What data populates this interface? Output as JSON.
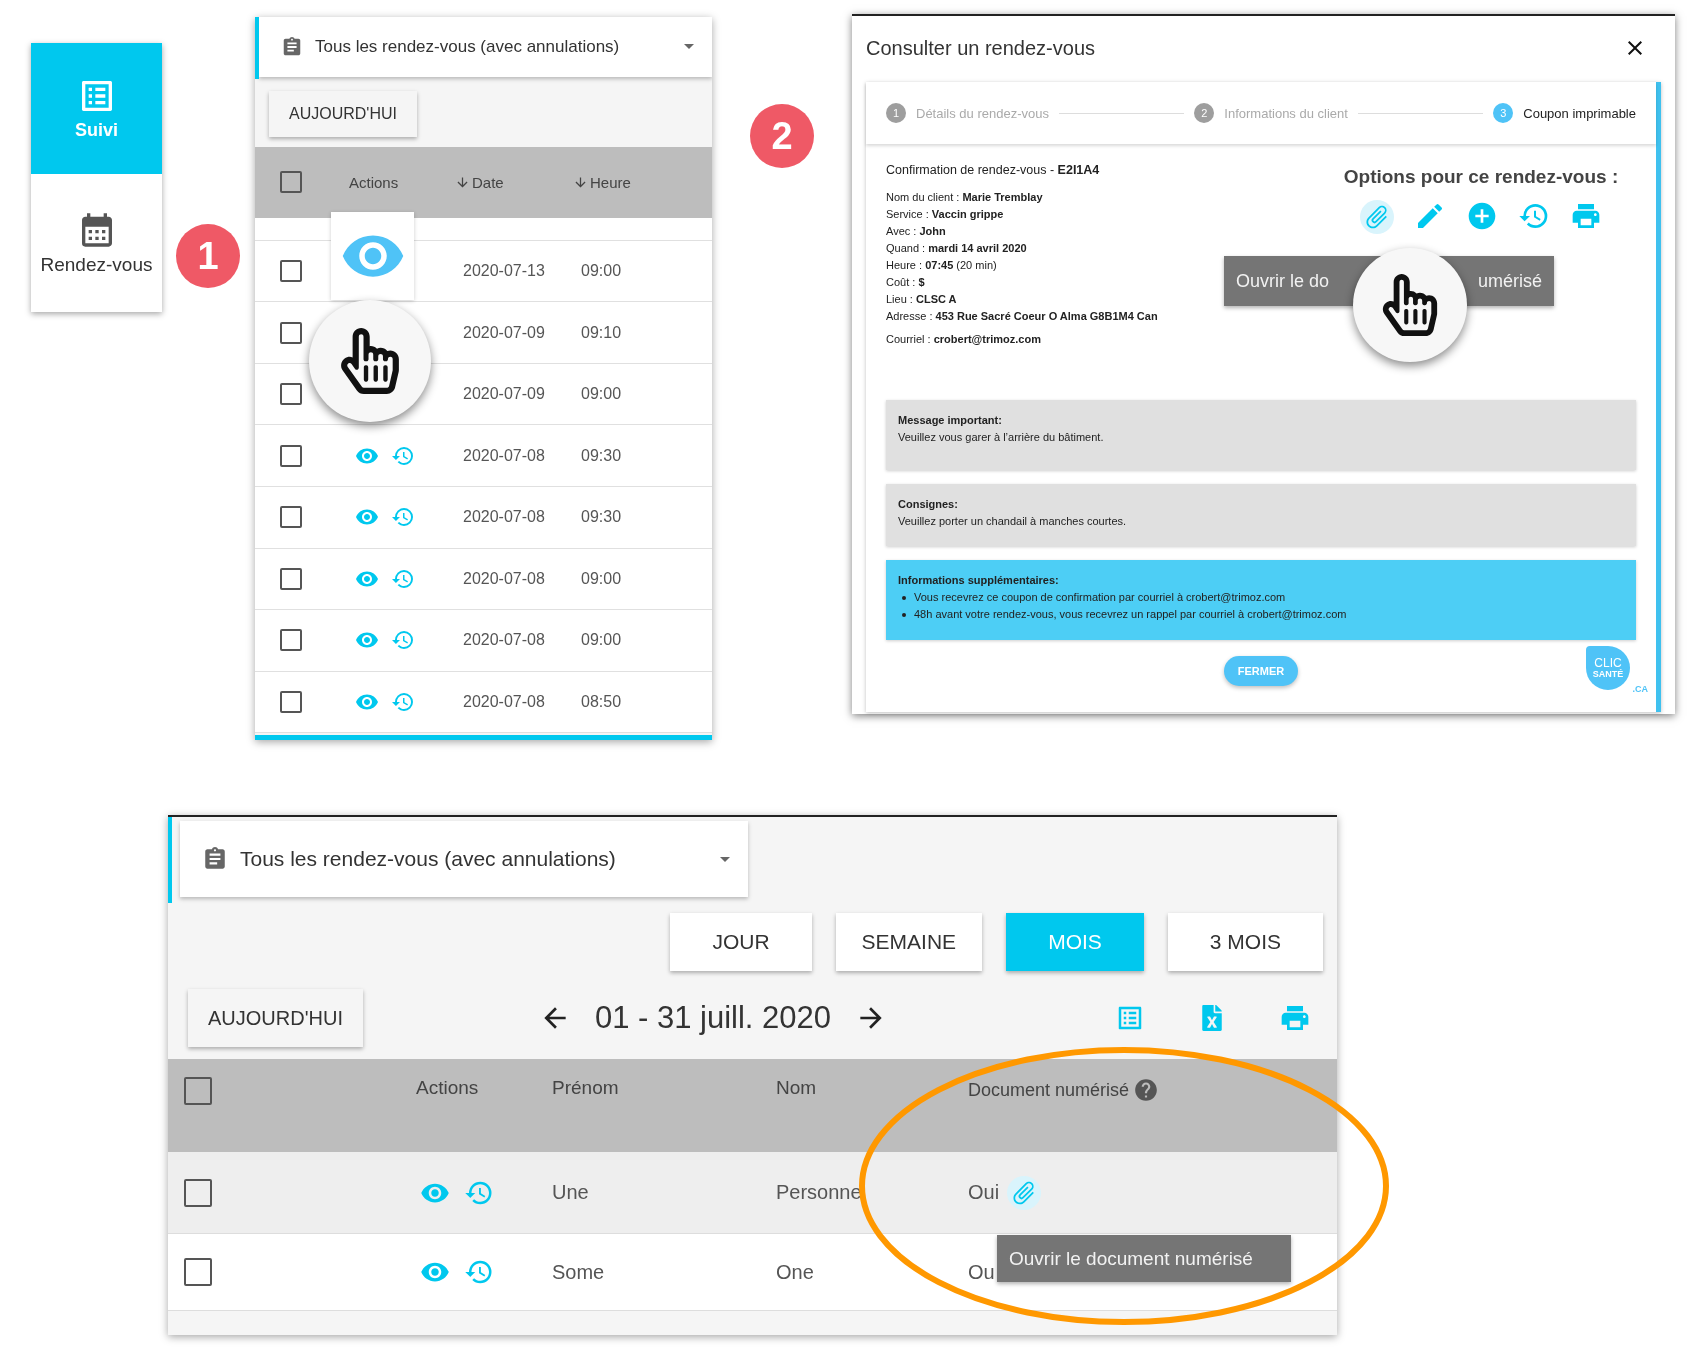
{
  "sidebar": {
    "items": [
      {
        "label": "Suivi",
        "selected": true
      },
      {
        "label": "Rendez-vous",
        "selected": false
      }
    ]
  },
  "step_badges": [
    "1",
    "2"
  ],
  "list_panel": {
    "filter": "Tous les rendez-vous (avec annulations)",
    "today_button": "AUJOURD'HUI",
    "select_all_checked": false,
    "columns": [
      "Actions",
      "Date",
      "Heure"
    ],
    "rows": [
      {
        "date": "2020-07-13",
        "time": "09:00",
        "checked": false
      },
      {
        "date": "2020-07-09",
        "time": "09:10",
        "checked": false
      },
      {
        "date": "2020-07-09",
        "time": "09:00",
        "checked": false
      },
      {
        "date": "2020-07-08",
        "time": "09:30",
        "actions_shown": true,
        "checked": false
      },
      {
        "date": "2020-07-08",
        "time": "09:30",
        "actions_shown": true,
        "checked": false
      },
      {
        "date": "2020-07-08",
        "time": "09:00",
        "actions_shown": true,
        "checked": false
      },
      {
        "date": "2020-07-08",
        "time": "09:00",
        "actions_shown": true,
        "checked": false
      },
      {
        "date": "2020-07-08",
        "time": "08:50",
        "actions_shown": true,
        "checked": false
      }
    ]
  },
  "modal": {
    "title": "Consulter un rendez-vous",
    "steps": [
      {
        "number": "1",
        "label": "Détails du rendez-vous",
        "selected": false
      },
      {
        "number": "2",
        "label": "Informations du client",
        "selected": false
      },
      {
        "number": "3",
        "label": "Coupon imprimable",
        "selected": true
      }
    ],
    "confirmation": "Confirmation de rendez-vous - **E2I1A4**",
    "details": [
      "Nom du client : **Marie Tremblay**",
      "Service : **Vaccin grippe**",
      "Avec : **John**",
      "Quand : **mardi 14 avril 2020**",
      "Heure : **07:45** (20 min)",
      "Coût : **$**",
      "Lieu : **CLSC A**",
      "Adresse : **453 Rue Sacré Coeur O Alma G8B1M4 Can**"
    ],
    "email": "Courriel : **crobert@trimoz.com**",
    "options_title": "Options pour ce rendez-vous :",
    "tooltip_parts": [
      "Ouvrir le do",
      "umérisé"
    ],
    "notices": [
      {
        "title": "Message important:",
        "text": "Veuillez vous garer à l’arrière du bâtiment."
      },
      {
        "title": "Consignes:",
        "text": "Veuillez porter un chandail à manches courtes."
      }
    ],
    "info": {
      "title": "Informations supplémentaires:",
      "bullets": [
        "Vous recevrez ce coupon de confirmation par courriel à crobert@trimoz.com",
        "48h avant votre rendez-vous, vous recevrez un rappel par courriel à crobert@trimoz.com"
      ]
    },
    "close_button": "FERMER",
    "logo": {
      "lines": [
        "CLIC",
        "SANTÉ"
      ],
      "suffix": ".CA"
    }
  },
  "calendar_panel": {
    "filter": "Tous les rendez-vous (avec annulations)",
    "ranges": [
      {
        "label": "JOUR",
        "selected": false
      },
      {
        "label": "SEMAINE",
        "selected": false
      },
      {
        "label": "MOIS",
        "selected": true
      },
      {
        "label": "3 MOIS",
        "selected": false
      }
    ],
    "today_button": "AUJOURD'HUI",
    "period": "01 - 31 juill. 2020",
    "select_all_checked": false,
    "columns": [
      "Actions",
      "Prénom",
      "Nom",
      "Document numérisé"
    ],
    "rows": [
      {
        "first_name": "Une",
        "last_name": "Personne",
        "document": "Oui",
        "highlighted": true,
        "checked": false
      },
      {
        "first_name": "Some",
        "last_name": "One",
        "document": "Ou",
        "highlighted": false,
        "checked": false
      }
    ],
    "tooltip": "Ouvrir le document numérisé"
  }
}
